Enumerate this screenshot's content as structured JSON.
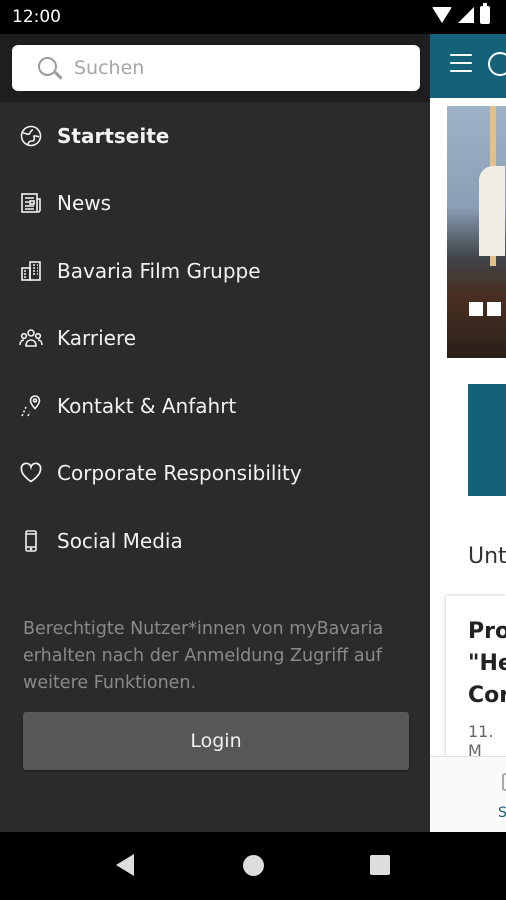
{
  "status_bar": {
    "time": "12:00"
  },
  "search": {
    "placeholder": "Suchen"
  },
  "nav_items": [
    {
      "label": "Startseite",
      "icon": "globe-icon",
      "active": true
    },
    {
      "label": "News",
      "icon": "newspaper-icon",
      "active": false
    },
    {
      "label": "Bavaria Film Gruppe",
      "icon": "buildings-icon",
      "active": false
    },
    {
      "label": "Karriere",
      "icon": "people-icon",
      "active": false
    },
    {
      "label": "Kontakt & Anfahrt",
      "icon": "map-pin-icon",
      "active": false
    },
    {
      "label": "Corporate Responsibility",
      "icon": "heart-icon",
      "active": false
    },
    {
      "label": "Social Media",
      "icon": "phone-icon",
      "active": false
    }
  ],
  "info_text": "Berechtigte Nutzer*innen von myBavaria erhalten nach der Anmeldung Zugriff auf weitere Funktionen.",
  "login_label": "Login",
  "background_app": {
    "section_title": "Unt",
    "news_title": "Pro\n\"He\nCor",
    "news_date": "11. M",
    "bottom_nav_label": "S"
  },
  "colors": {
    "drawer_bg": "#2b2b2b",
    "accent": "#13627a"
  }
}
